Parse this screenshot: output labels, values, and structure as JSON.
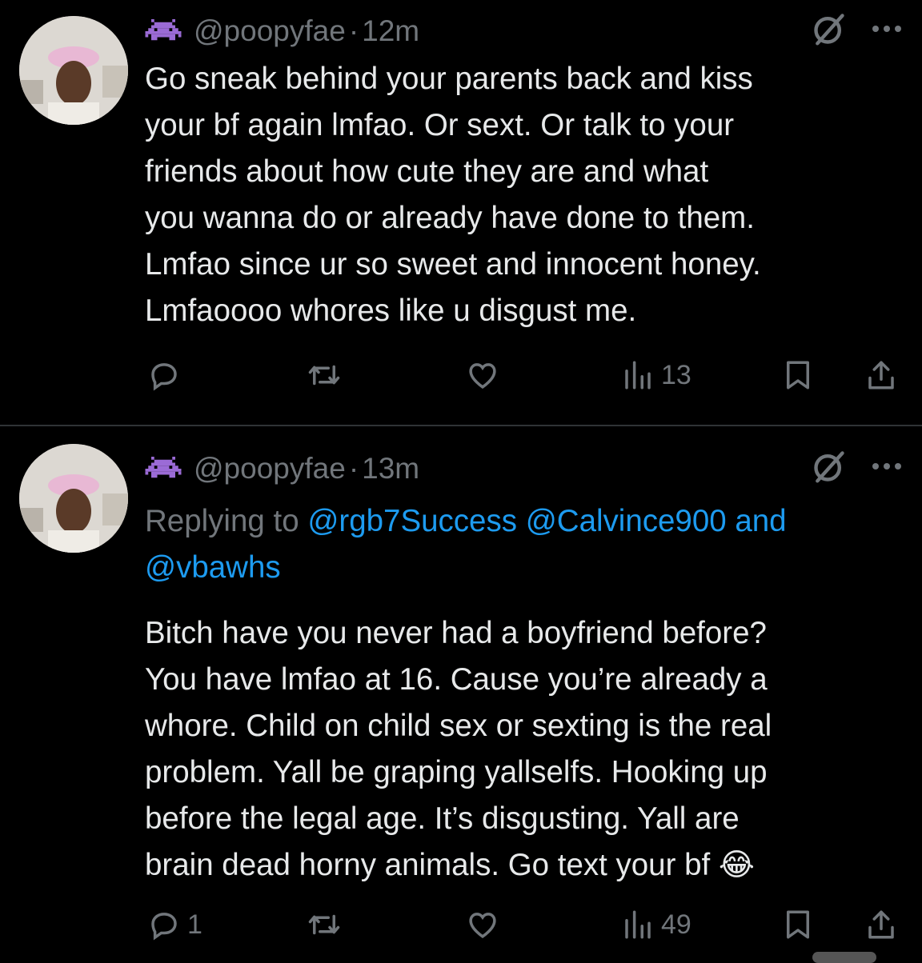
{
  "tweets": [
    {
      "handle": "@poopyfae",
      "separator": "·",
      "time": "12m",
      "replying_prefix": "",
      "replying_to": [],
      "body": "Go sneak behind your parents back and kiss\nyour bf again lmfao. Or sext. Or talk to your\nfriends about how cute they are and what\nyou wanna do or already have done to them.\nLmfao since ur so sweet and innocent honey.\nLmfaoooo whores like u disgust me.",
      "actions": {
        "reply": "",
        "repost": "",
        "like": "",
        "views": "13"
      }
    },
    {
      "handle": "@poopyfae",
      "separator": "·",
      "time": "13m",
      "replying_prefix": "Replying to",
      "replying_to": [
        "@rgb7Success",
        "@Calvince900",
        "and",
        "@vbawhs"
      ],
      "body": "Bitch have you never had a boyfriend before?\nYou have lmfao at 16.  Cause you’re already a\nwhore. Child on child sex or sexting is the real\nproblem. Yall be graping yallselfs. Hooking up\nbefore the legal age. It’s disgusting. Yall are\nbrain dead horny animals. Go text your bf 😂",
      "actions": {
        "reply": "1",
        "repost": "",
        "like": "",
        "views": "49"
      }
    }
  ],
  "icons": [
    "space-invader-icon",
    "grok-icon",
    "more-icon",
    "reply-icon",
    "repost-icon",
    "like-icon",
    "views-icon",
    "bookmark-icon",
    "share-icon"
  ],
  "colors": {
    "background": "#000000",
    "text": "#e7e9ea",
    "secondary": "#71767b",
    "link": "#1d9bf0",
    "divider": "#2f3336",
    "badge": "#9b6bd6"
  }
}
